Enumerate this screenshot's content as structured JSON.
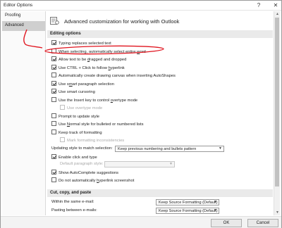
{
  "window": {
    "title": "Editor Options",
    "help": "?",
    "close": "✕"
  },
  "sidebar": {
    "items": [
      {
        "label": "Proofing"
      },
      {
        "label": "Advanced"
      }
    ]
  },
  "header": {
    "text": "Advanced customization for working with Outlook"
  },
  "editing": {
    "title": "Editing options",
    "options": [
      {
        "pre": "Typing replaces selected text",
        "checked": true
      },
      {
        "pre": "When selecting, automatically select entire ",
        "u": "w",
        "post": "ord",
        "checked": false
      },
      {
        "pre": "Allow text to be ",
        "u": "d",
        "post": "ragged and dropped",
        "checked": true
      },
      {
        "pre": "Use CTRL + Click to follow ",
        "u": "h",
        "post": "yperlink",
        "checked": true
      },
      {
        "pre": "Automatically create drawing canvas when inserting AutoShapes",
        "checked": false
      },
      {
        "pre": "Use s",
        "u": "m",
        "post": "art paragraph selection",
        "checked": true
      },
      {
        "pre": "Use smart cursoring",
        "checked": true
      },
      {
        "pre": "Use the Insert key to control ",
        "u": "o",
        "post": "vertype mode",
        "checked": false
      },
      {
        "pre": "Use overtype mode",
        "checked": false,
        "disabled": true,
        "indent": true
      },
      {
        "pre": "Prompt to update style",
        "checked": false
      },
      {
        "pre": "Use ",
        "u": "N",
        "post": "ormal style for bulleted or numbered lists",
        "checked": false
      },
      {
        "pre": "Keep track of formatting",
        "checked": false
      },
      {
        "pre": "Mark formatting inconsistencies",
        "checked": false,
        "disabled": true,
        "indent": true
      }
    ],
    "updating_label": "Updating style to match selection:",
    "updating_value": "Keep previous numbering and bullets pattern",
    "click_type_label": "Enable click and type",
    "default_para_label": "Default paragraph style:",
    "autocomplete_label": "Show AutoComplete suggestions",
    "no_hyperlink_label": "Do not automatically hyperlink screenshot"
  },
  "cutcopy": {
    "title": "Cut, copy, and paste",
    "within_label": "Within the same e-mail:",
    "within_value": "Keep Source Formatting (Default)",
    "between_label": "Pasting between e-mails:",
    "between_value": "Keep Source Formatting (Default)"
  },
  "footer": {
    "ok": "OK",
    "cancel": "Cancel"
  },
  "colors": {
    "annotation": "#e0141e",
    "selected_nav": "#cfcfcf",
    "section_bg": "#eaeaea"
  }
}
